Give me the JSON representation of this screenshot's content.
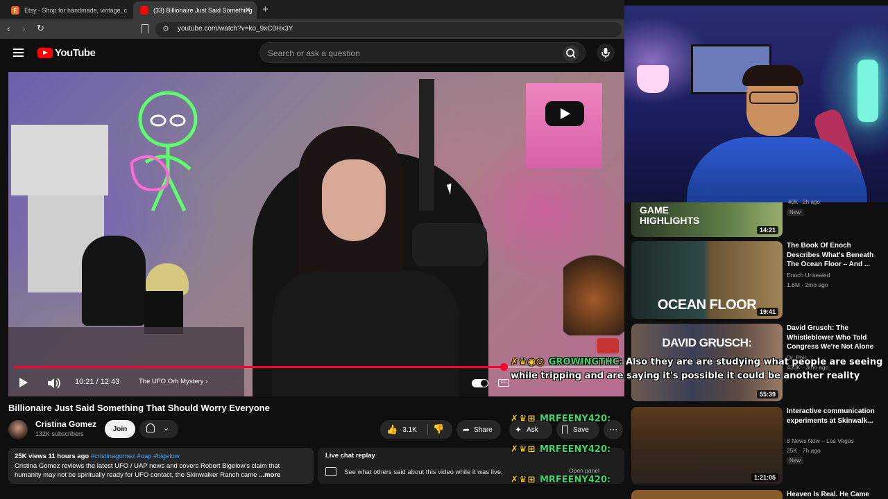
{
  "browser": {
    "tabs": [
      {
        "label": "Etsy - Shop for handmade, vintage, c",
        "favicon": "E"
      },
      {
        "label": "(33) Billionaire Just Said Something"
      }
    ],
    "url": "youtube.com/watch?v=ko_9xC0Hx3Y"
  },
  "header": {
    "logo": "YouTube",
    "search_placeholder": "Search or ask a question"
  },
  "player": {
    "time": "10:21 / 12:43",
    "chapter": "The UFO Orb Mystery",
    "progress": 0.81,
    "cc_label": "CC"
  },
  "video": {
    "title": "Billionaire Just Said Something That Should Worry Everyone",
    "channel": "Cristina Gomez",
    "subscribers": "132K subscribers",
    "join_label": "Join",
    "likes": "3.1K",
    "share_label": "Share",
    "ask_label": "Ask",
    "save_label": "Save"
  },
  "description": {
    "views": "25K views",
    "age": "11 hours ago",
    "tags": "#cristinagomez #uap #bigelow",
    "line1": "Cristina Gomez reviews the latest UFO / UAP news and covers Robert Bigelow's claim that",
    "line2": "humanity may not be spiritually ready for UFO contact, the Skinwalker Ranch came",
    "more": "...more"
  },
  "live_chat": {
    "title": "Live chat replay",
    "desc": "See what others said about this video while it was live.",
    "open_panel": "Open panel"
  },
  "related": {
    "partial_meta": "40K · 2h ago",
    "partial_badge": "New",
    "partial_thumb_text": "GAME\nHIGHLIGHTS",
    "partial_duration": "14:21",
    "items": [
      {
        "title": "The Book Of Enoch Describes What's Beneath The Ocean Floor – And ...",
        "channel": "Enoch Unsealed",
        "meta": "1.6M · 2mo ago",
        "duration": "19:41",
        "thumb_text": "OCEAN FLOOR"
      },
      {
        "title": "David Grusch: The Whistleblower Who Told Congress We're Not Alone",
        "channel": "Dr. Phil",
        "meta": "430K · 3mo ago",
        "duration": "55:39",
        "thumb_text": "DAVID GRUSCH:"
      },
      {
        "title": "Interactive communication experiments at Skinwalk...",
        "channel": "8 News Now – Las Vegas",
        "meta": "25K · 7h ago",
        "badge": "New",
        "duration": "1:21:05"
      }
    ],
    "last_title": "Heaven Is Real. He Came"
  },
  "stream_chat": {
    "main": {
      "user": "GROWINGTHC:",
      "message": "Also they are are studying what people are seeing while tripping and are saying it's possible it could be another reality"
    },
    "lines": [
      {
        "user": "MRFEENY420:"
      },
      {
        "user": "MRFEENY420:"
      },
      {
        "user": "MRFEENY420:"
      }
    ]
  },
  "colors": {
    "accent_red": "#ff0033",
    "chat_name_green": "#3fd46b",
    "tag_blue": "#3ea6ff"
  }
}
